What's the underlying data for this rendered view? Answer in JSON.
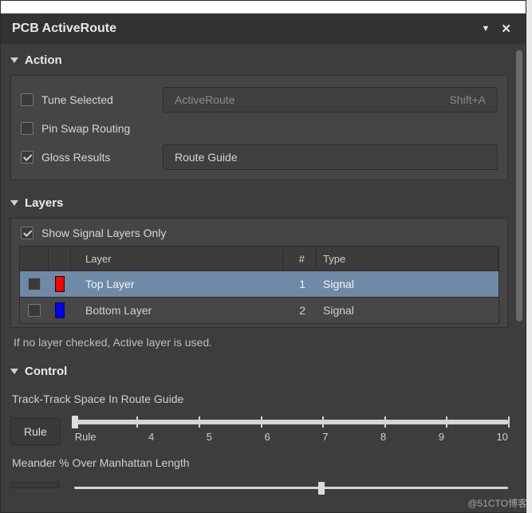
{
  "panel": {
    "title": "PCB ActiveRoute",
    "dropdown_icon": "panel-dropdown-icon",
    "close_icon": "panel-close-icon"
  },
  "action": {
    "header": "Action",
    "tune_selected": {
      "label": "Tune Selected",
      "checked": false
    },
    "pin_swap": {
      "label": "Pin Swap Routing",
      "checked": false
    },
    "gloss": {
      "label": "Gloss Results",
      "checked": true
    },
    "activeroute_btn": {
      "label": "ActiveRoute",
      "shortcut": "Shift+A"
    },
    "routeguide_btn": {
      "label": "Route Guide"
    }
  },
  "layers": {
    "header": "Layers",
    "show_signal_only": {
      "label": "Show Signal Layers Only",
      "checked": true
    },
    "columns": {
      "layer": "Layer",
      "num": "#",
      "type": "Type"
    },
    "rows": [
      {
        "name": "Top Layer",
        "num": "1",
        "type": "Signal",
        "color": "#ff0000",
        "checked": false,
        "selected": true
      },
      {
        "name": "Bottom Layer",
        "num": "2",
        "type": "Signal",
        "color": "#0000ff",
        "checked": false,
        "selected": false
      }
    ],
    "note": "If no layer checked, Active layer is used."
  },
  "control": {
    "header": "Control",
    "track_space": {
      "label": "Track-Track Space In Route Guide",
      "value": "Rule",
      "ticks": [
        "Rule",
        "4",
        "5",
        "6",
        "7",
        "8",
        "9",
        "10"
      ],
      "thumb_pct": 0
    },
    "meander": {
      "label": "Meander % Over Manhattan Length",
      "thumb_pct": 57
    }
  },
  "watermark": "@51CTO博客"
}
